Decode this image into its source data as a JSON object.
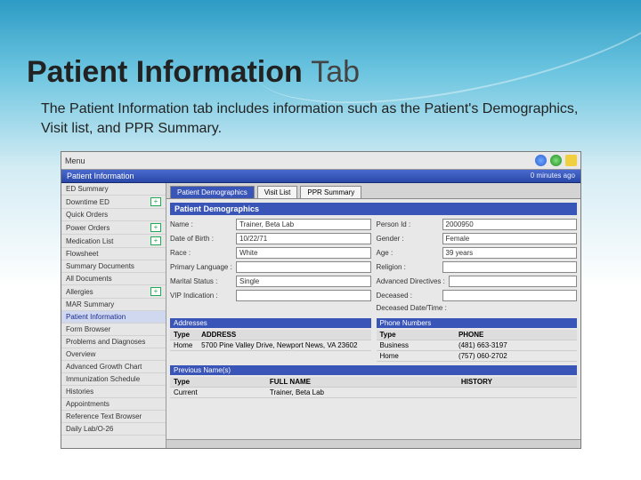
{
  "slide": {
    "title_a": "Patient Information",
    "title_b": "Tab",
    "desc": "The Patient Information tab includes information such as the Patient's Demographics, Visit list, and PPR Summary."
  },
  "toolbar": {
    "menu": "Menu"
  },
  "titlebar": {
    "label": "Patient Information",
    "status": "0 minutes ago"
  },
  "sidebar": {
    "items": [
      {
        "label": "ED Summary",
        "plus": false
      },
      {
        "label": "Downtime ED",
        "plus": true
      },
      {
        "label": "Quick Orders",
        "plus": false
      },
      {
        "label": "Power Orders",
        "plus": true
      },
      {
        "label": "Medication List",
        "plus": true
      },
      {
        "label": "Flowsheet",
        "plus": false
      },
      {
        "label": "Summary Documents",
        "plus": false
      },
      {
        "label": "All Documents",
        "plus": false
      },
      {
        "label": "Allergies",
        "plus": true
      },
      {
        "label": "MAR Summary",
        "plus": false
      },
      {
        "label": "Patient Information",
        "plus": false,
        "sel": true
      },
      {
        "label": "Form Browser",
        "plus": false
      },
      {
        "label": "Problems and Diagnoses",
        "plus": false
      },
      {
        "label": "Overview",
        "plus": false
      },
      {
        "label": "Advanced Growth Chart",
        "plus": false
      },
      {
        "label": "Immunization Schedule",
        "plus": false
      },
      {
        "label": "Histories",
        "plus": false
      },
      {
        "label": "Appointments",
        "plus": false
      },
      {
        "label": "Reference Text Browser",
        "plus": false
      },
      {
        "label": "Daily Lab/O-26",
        "plus": false
      }
    ]
  },
  "tabs": [
    {
      "label": "Patient Demographics",
      "active": true
    },
    {
      "label": "Visit List",
      "active": false
    },
    {
      "label": "PPR Summary",
      "active": false
    }
  ],
  "section": "Patient Demographics",
  "demo": {
    "name_l": "Name :",
    "name_v": "Trainer, Beta Lab",
    "person_l": "Person Id :",
    "person_v": "2000950",
    "dob_l": "Date of Birth :",
    "dob_v": "10/22/71",
    "gender_l": "Gender :",
    "gender_v": "Female",
    "race_l": "Race :",
    "race_v": "White",
    "age_l": "Age :",
    "age_v": "39 years",
    "lang_l": "Primary Language :",
    "lang_v": "",
    "religion_l": "Religion :",
    "religion_v": "",
    "marital_l": "Marital Status :",
    "marital_v": "Single",
    "adv_l": "Advanced Directives :",
    "adv_v": "",
    "vip_l": "VIP Indication :",
    "vip_v": "",
    "dec_l": "Deceased :",
    "dec_v": "",
    "decd_l": "Deceased Date/Time :"
  },
  "addresses": {
    "title": "Addresses",
    "col1": "Type",
    "col2": "ADDRESS",
    "rows": [
      {
        "type": "Home",
        "addr": "5700 Pine Valley Drive,  Newport News, VA 23602"
      }
    ]
  },
  "phones": {
    "title": "Phone Numbers",
    "col1": "Type",
    "col2": "PHONE",
    "rows": [
      {
        "type": "Business",
        "ph": "(481) 663-3197"
      },
      {
        "type": "Home",
        "ph": "(757) 060-2702"
      }
    ]
  },
  "prev": {
    "title": "Previous Name(s)",
    "col1": "Type",
    "col2": "FULL NAME",
    "col3": "HISTORY",
    "rows": [
      {
        "type": "Current",
        "name": "Trainer, Beta Lab",
        "hist": ""
      }
    ]
  }
}
